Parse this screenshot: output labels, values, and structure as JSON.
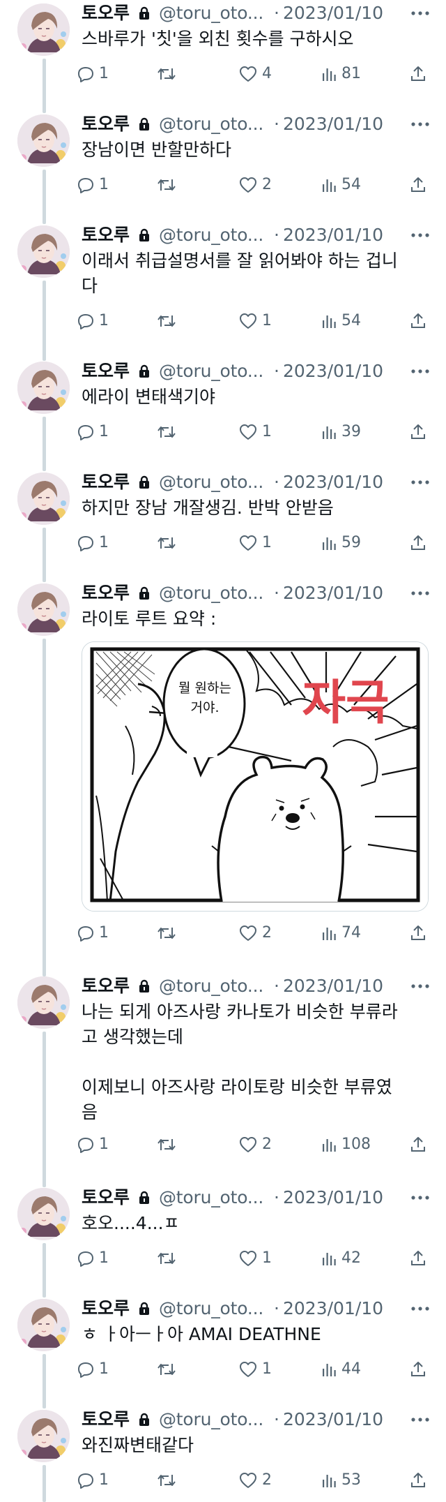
{
  "author": {
    "name": "토오루",
    "handle": "@toru_oto...",
    "separator": "·",
    "avatar_icon": "avatar-portrait",
    "lock_icon": "lock-icon"
  },
  "colors": {
    "text": "#0f1419",
    "muted": "#536471",
    "thread_line": "#cfd9de",
    "manga_red": "#e0464e"
  },
  "tweets": [
    {
      "date": "2023/01/10",
      "text": "스바루가 '칫'을 외친 횟수를 구하시오",
      "replies": "1",
      "likes": "4",
      "views": "81"
    },
    {
      "date": "2023/01/10",
      "text": "장남이면 반할만하다",
      "replies": "1",
      "likes": "2",
      "views": "54"
    },
    {
      "date": "2023/01/10",
      "text": "이래서 취급설명서를 잘 읽어봐야 하는 겁니\n다",
      "replies": "1",
      "likes": "1",
      "views": "54"
    },
    {
      "date": "2023/01/10",
      "text": "에라이 변태색기야",
      "replies": "1",
      "likes": "1",
      "views": "39"
    },
    {
      "date": "2023/01/10",
      "text": "하지만 장남 개잘생김. 반박 안받음",
      "replies": "1",
      "likes": "1",
      "views": "59"
    },
    {
      "date": "2023/01/10",
      "text": "라이토 루트 요약 :",
      "replies": "1",
      "likes": "2",
      "views": "74",
      "media": {
        "bubble_text_line1": "뭘 원하는",
        "bubble_text_line2": "거야.",
        "sfx": "자극"
      }
    },
    {
      "date": "2023/01/10",
      "text": "나는 되게 아즈사랑 카나토가 비슷한 부류라\n고 생각했는데\n\n이제보니 아즈사랑 라이토랑 비슷한 부류였\n음",
      "replies": "1",
      "likes": "2",
      "views": "108"
    },
    {
      "date": "2023/01/10",
      "text": "호오....4...ㅍ",
      "replies": "1",
      "likes": "1",
      "views": "42"
    },
    {
      "date": "2023/01/10",
      "text": "ㅎ ㅏ아ㅡㅏ아 AMAI DEATHNE",
      "replies": "1",
      "likes": "1",
      "views": "44"
    },
    {
      "date": "2023/01/10",
      "text": "와진짜변태같다",
      "replies": "1",
      "likes": "2",
      "views": "53"
    }
  ]
}
